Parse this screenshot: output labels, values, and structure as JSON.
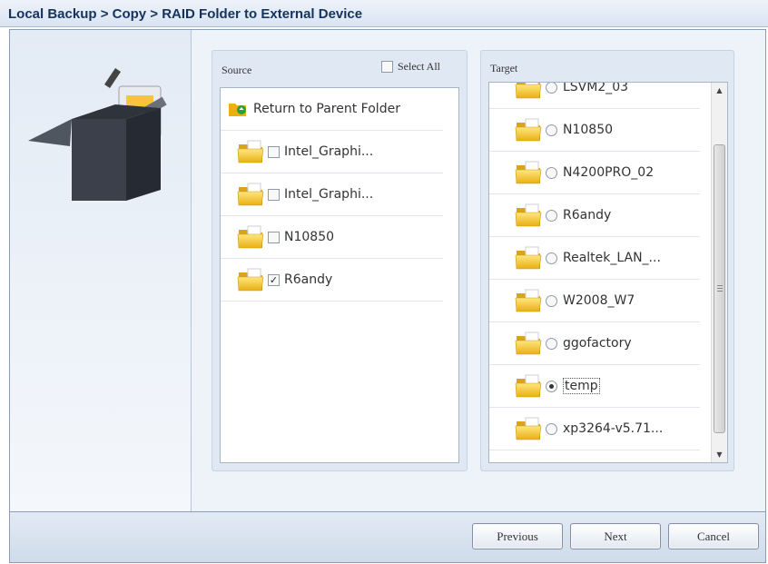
{
  "window": {
    "title": "Local Backup > Copy > RAID Folder to External Device"
  },
  "source": {
    "label": "Source",
    "select_all_label": "Select All",
    "select_all_checked": false,
    "parent_link": "Return to Parent Folder",
    "items": [
      {
        "name": "Intel_Graphi...",
        "checked": false
      },
      {
        "name": "Intel_Graphi...",
        "checked": false
      },
      {
        "name": "N10850",
        "checked": false
      },
      {
        "name": "R6andy",
        "checked": true
      }
    ]
  },
  "target": {
    "label": "Target",
    "selected": "temp",
    "items": [
      {
        "name": "LSVM2_03"
      },
      {
        "name": "N10850"
      },
      {
        "name": "N4200PRO_02"
      },
      {
        "name": "R6andy"
      },
      {
        "name": "Realtek_LAN_..."
      },
      {
        "name": "W2008_W7"
      },
      {
        "name": "ggofactory"
      },
      {
        "name": "temp"
      },
      {
        "name": "xp3264-v5.71..."
      }
    ]
  },
  "buttons": {
    "previous": "Previous",
    "next": "Next",
    "cancel": "Cancel"
  },
  "colors": {
    "title_text": "#15345c",
    "frame_border": "#8a9db7",
    "folder": "#f2c631"
  }
}
